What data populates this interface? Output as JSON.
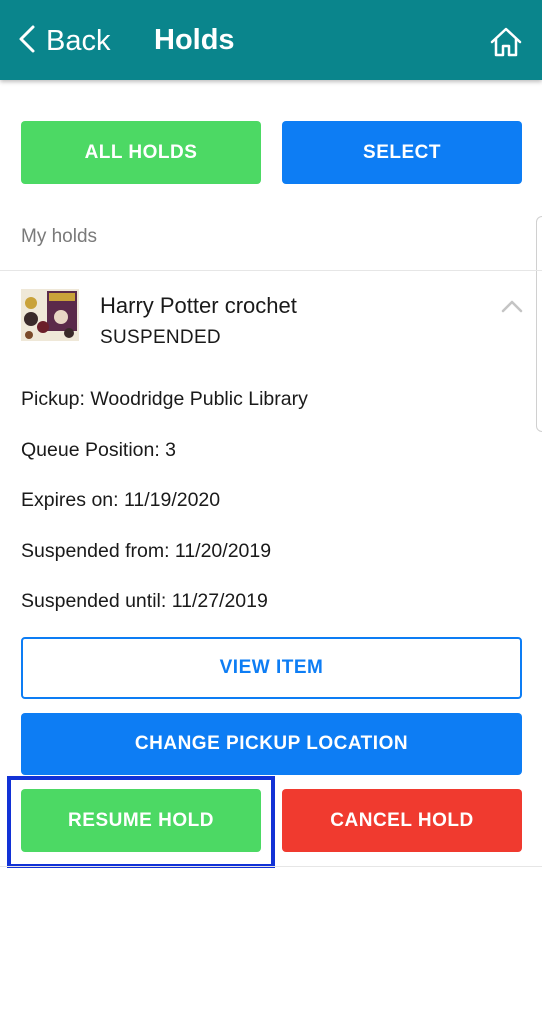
{
  "header": {
    "back_label": "Back",
    "title": "Holds",
    "back_icon": "chevron-left-icon",
    "home_icon": "home-icon",
    "background": "#0a858c"
  },
  "actions": {
    "all_holds_label": "ALL HOLDS",
    "select_label": "SELECT"
  },
  "section_label": "My holds",
  "hold": {
    "title": "Harry Potter crochet",
    "status": "SUSPENDED",
    "cover_icon": "book-cover-thumbnail",
    "collapse_icon": "chevron-up-icon",
    "details": {
      "pickup": "Pickup: Woodridge Public Library",
      "queue_position": "Queue Position: 3",
      "expires_on": "Expires on: 11/19/2020",
      "suspended_from": "Suspended from: 11/20/2019",
      "suspended_until": "Suspended until: 11/27/2019"
    },
    "buttons": {
      "view_item": "VIEW ITEM",
      "change_pickup": "CHANGE PICKUP LOCATION",
      "resume_hold": "RESUME HOLD",
      "cancel_hold": "CANCEL HOLD"
    }
  },
  "colors": {
    "green": "#4cd964",
    "blue": "#0d7df4",
    "red": "#f03a2f",
    "highlight": "#1232d6"
  }
}
